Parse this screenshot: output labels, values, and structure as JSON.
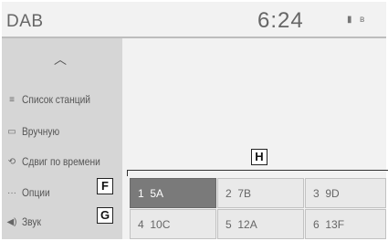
{
  "header": {
    "title": "DAB",
    "time": "6:24",
    "status_icons": [
      "battery-icon",
      "bluetooth-icon"
    ]
  },
  "sidebar": {
    "collapse_icon": "chevron-up-icon",
    "items": [
      {
        "label": "Список станций",
        "icon": "station-list-icon"
      },
      {
        "label": "Вручную",
        "icon": "manual-tune-icon"
      },
      {
        "label": "Сдвиг по времени",
        "icon": "time-shift-icon"
      },
      {
        "label": "Опции",
        "icon": "options-icon"
      },
      {
        "label": "Звук",
        "icon": "speaker-icon"
      }
    ]
  },
  "presets": [
    {
      "number": "1",
      "channel": "5A",
      "active": true
    },
    {
      "number": "2",
      "channel": "7B",
      "active": false
    },
    {
      "number": "3",
      "channel": "9D",
      "active": false
    },
    {
      "number": "4",
      "channel": "10C",
      "active": false
    },
    {
      "number": "5",
      "channel": "12A",
      "active": false
    },
    {
      "number": "6",
      "channel": "13F",
      "active": false
    }
  ],
  "callouts": {
    "presets": "H",
    "options": "F",
    "sound": "G"
  }
}
